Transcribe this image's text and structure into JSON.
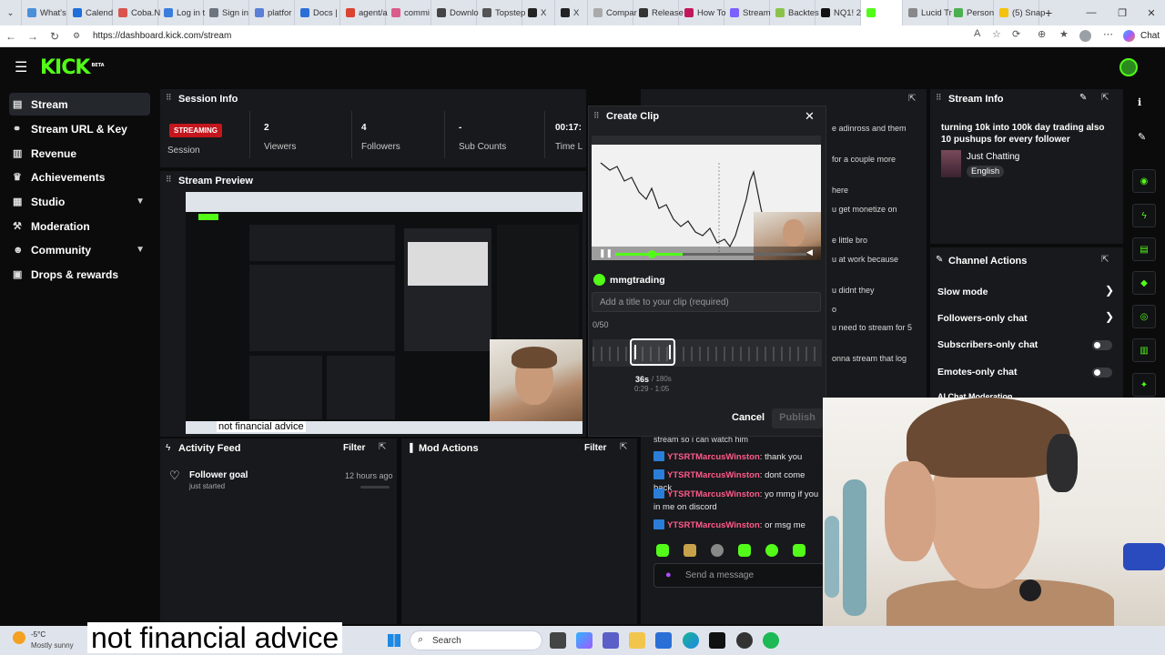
{
  "browser": {
    "tabs": [
      "What's",
      "Calend",
      "Coba.N",
      "Log in t",
      "Sign in",
      "platfor",
      "Docs |",
      "agent/a",
      "commi",
      "Downlo",
      "Topstep",
      "X",
      "X",
      "Compar",
      "Release",
      "How To",
      "Stream",
      "Backtes",
      "NQ1! 2",
      "",
      "Lucid Tr",
      "Person",
      "(5) Snap"
    ],
    "url": "https://dashboard.kick.com/stream",
    "chat_label": "Chat"
  },
  "app": {
    "logo": "KICK",
    "logo_badge": "BETA"
  },
  "sidebar": {
    "items": [
      {
        "label": "Stream",
        "icon": "stream-icon"
      },
      {
        "label": "Stream URL & Key",
        "icon": "link-icon"
      },
      {
        "label": "Revenue",
        "icon": "revenue-icon"
      },
      {
        "label": "Achievements",
        "icon": "trophy-icon"
      },
      {
        "label": "Studio",
        "icon": "studio-icon"
      },
      {
        "label": "Moderation",
        "icon": "hammer-icon"
      },
      {
        "label": "Community",
        "icon": "community-icon"
      },
      {
        "label": "Drops & rewards",
        "icon": "gift-icon"
      }
    ]
  },
  "session": {
    "title": "Session Info",
    "status": "STREAMING",
    "stats": [
      {
        "value": "",
        "label": "Session"
      },
      {
        "value": "2",
        "label": "Viewers"
      },
      {
        "value": "4",
        "label": "Followers"
      },
      {
        "value": "-",
        "label": "Sub Counts"
      },
      {
        "value": "00:17:",
        "label": "Time L"
      }
    ]
  },
  "preview": {
    "title": "Stream Preview",
    "caption": "not financial advice"
  },
  "activity": {
    "title": "Activity Feed",
    "filter": "Filter",
    "goal_title": "Follower goal",
    "goal_sub": "just started",
    "goal_time": "12 hours ago"
  },
  "mod_actions": {
    "title": "Mod Actions",
    "filter": "Filter"
  },
  "chat": {
    "faded": [
      "e adinross and them",
      "for a couple more",
      "here",
      "u get monetize on",
      "e little bro",
      "u at work because",
      "u didnt they",
      "o",
      "u need to stream for 5",
      "onna stream that log"
    ],
    "cut_line": "stream so i can watch him",
    "messages": [
      {
        "user": "YTSRTMarcusWinston",
        "text": ": thank you"
      },
      {
        "user": "YTSRTMarcusWinston",
        "text": ": dont come back"
      },
      {
        "user": "YTSRTMarcusWinston",
        "text": ": yo mmg if you in me on discord"
      },
      {
        "user": "YTSRTMarcusWinston",
        "text": ": or msg me"
      }
    ],
    "send_placeholder": "Send a message"
  },
  "clip_modal": {
    "title": "Create Clip",
    "channel": "mmgtrading",
    "title_placeholder": "Add a title to your clip (required)",
    "char_count": "0/50",
    "duration": "36s",
    "max": "/ 180s",
    "range": "0:29 - 1:05",
    "cancel": "Cancel",
    "publish": "Publish"
  },
  "stream_info": {
    "title": "Stream Info",
    "stream_title": "turning 10k into 100k day trading also 10 pushups for every follower",
    "category": "Just Chatting",
    "language": "English"
  },
  "channel_actions": {
    "title": "Channel Actions",
    "items": [
      "Slow mode",
      "Followers-only chat",
      "Subscribers-only chat",
      "Emotes-only chat"
    ],
    "cut_item": "AI Chat Moderation"
  },
  "overlay": {
    "caption": "not financial advice"
  },
  "taskbar": {
    "temp": "-5°C",
    "weather": "Mostly sunny",
    "search": "Search"
  },
  "colors": {
    "accent": "#53fc18",
    "live": "#c4161c",
    "chat_user": "#ff5a8a",
    "panel": "#18191c"
  }
}
